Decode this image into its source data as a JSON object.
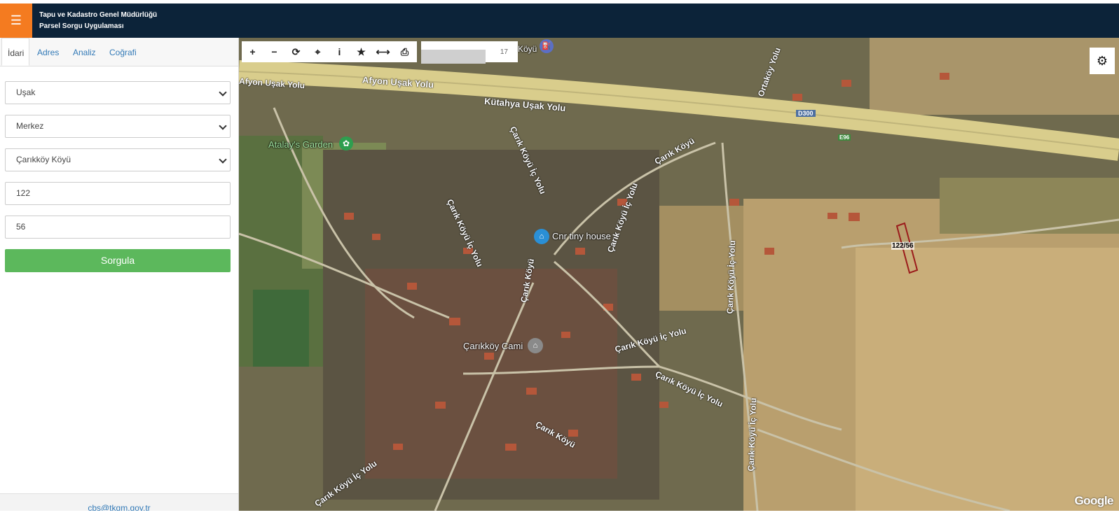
{
  "header": {
    "title_line1": "Tapu ve Kadastro Genel Müdürlüğü",
    "title_line2": "Parsel Sorgu Uygulaması",
    "menu_icon": "☰"
  },
  "sidebar": {
    "tabs": [
      {
        "label": "İdari",
        "active": true
      },
      {
        "label": "Adres"
      },
      {
        "label": "Analiz"
      },
      {
        "label": "Coğrafi"
      }
    ],
    "province": "Uşak",
    "district": "Merkez",
    "neighborhood": "Çarıkköy Köyü",
    "block": "122",
    "parcel": "56",
    "query_button": "Sorgula",
    "footer_email": "cbs@tkgm.gov.tr"
  },
  "map": {
    "toolbar": [
      {
        "icon": "zoom-in-icon",
        "glyph": "+"
      },
      {
        "icon": "zoom-out-icon",
        "glyph": "−"
      },
      {
        "icon": "refresh-icon",
        "glyph": "⟳"
      },
      {
        "icon": "locate-icon",
        "glyph": "⌖"
      },
      {
        "icon": "info-icon",
        "glyph": "i"
      },
      {
        "icon": "star-icon",
        "glyph": "★"
      },
      {
        "icon": "measure-icon",
        "glyph": "⟷"
      },
      {
        "icon": "print-icon",
        "glyph": "⎙"
      }
    ],
    "zoom_level": "17",
    "settings_icon": "⚙",
    "attribution": "Google",
    "parcel_label": "122/56",
    "labels": {
      "afyon": "Afyon Uşak Yolu",
      "kutahya": "Kütahya Uşak Yolu",
      "ortakoy": "Ortaköy Yolu",
      "d300": "D300",
      "e96": "E96",
      "koyu_top": "Köyü",
      "carik_koyu_1": "Çarık Köyü",
      "carik_ic_1": "Çarık Köyü İç Yolu",
      "carik_ic_2": "Çarık Köyü İç Yolu",
      "carik_ic_3": "Çarık Köyü İç Yolu",
      "carik_ic_4": "Çarık Köyü İç Yolu",
      "carik_ic_5": "Çarık Köyü İç Yolu",
      "carik_ic_6": "Çarık Köyü İç Yolu",
      "carik_ic_7": "Çarık Köyü İç Yolu",
      "carik_koyu_2": "Çarık Köyü",
      "carik_koyu_3": "Çarık Köyü",
      "atalay": "Atalay's Garden",
      "tinyhouse": "Cnr tiny house",
      "cami": "Çarıkköy Cami"
    }
  }
}
